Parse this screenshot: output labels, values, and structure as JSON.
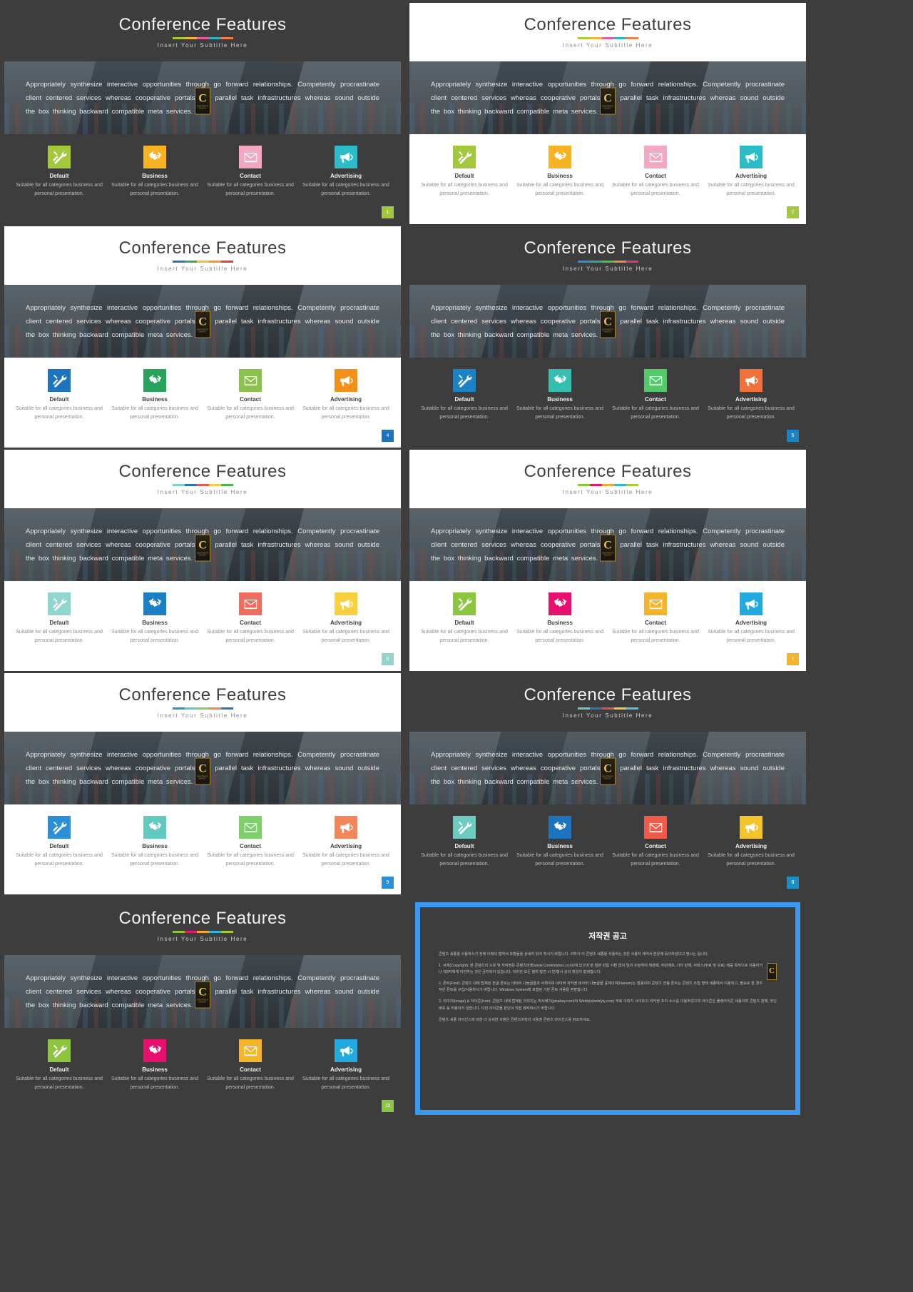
{
  "slide_common": {
    "title": "Conference Features",
    "subtitle": "Insert Your Subtitle Here",
    "paragraph": "Appropriately synthesize interactive opportunities through go forward relationships. Competently procrastinate client centered services whereas cooperative portals and parallel task infrastructures whereas sound outside the box thinking backward compatible meta services.",
    "watermark_letter": "C",
    "watermark_line1": "CONTENTS",
    "watermark_line2": "MARKET",
    "features": [
      {
        "name": "Default",
        "icon": "tools-icon",
        "desc": "Suitable for all categories business and personal presentation."
      },
      {
        "name": "Business",
        "icon": "handshake-icon",
        "desc": "Suitable for all categories business and personal presentation."
      },
      {
        "name": "Contact",
        "icon": "envelope-icon",
        "desc": "Suitable for all categories business and personal presentation."
      },
      {
        "name": "Advertising",
        "icon": "megaphone-icon",
        "desc": "Suitable for all categories business and personal presentation."
      }
    ]
  },
  "slides": [
    {
      "number": "1",
      "theme": "t-dark",
      "rule_colors": [
        "#a8c93a",
        "#f0b53c",
        "#e0609b",
        "#2eb5bd",
        "#f0814a"
      ],
      "icon_colors": [
        "#a4c83c",
        "#f7b322",
        "#f4a8c0",
        "#2cbcc8"
      ],
      "badge_color": "#a4c83c"
    },
    {
      "number": "2",
      "theme": "t-light",
      "rule_colors": [
        "#a8c93a",
        "#f0b53c",
        "#e0609b",
        "#2eb5bd",
        "#f0814a"
      ],
      "icon_colors": [
        "#a4c83c",
        "#f7b322",
        "#f4a8c0",
        "#2cbcc8"
      ],
      "badge_color": "#a4c83c"
    },
    {
      "number": "4",
      "theme": "t-light",
      "rule_colors": [
        "#2f74b5",
        "#3fa65a",
        "#f0c030",
        "#f2962c",
        "#d9443c"
      ],
      "icon_colors": [
        "#1b74bd",
        "#27a35c",
        "#8cc152",
        "#f39019"
      ],
      "badge_color": "#1b74bd"
    },
    {
      "number": "5",
      "theme": "t-dark",
      "rule_colors": [
        "#2f8fd0",
        "#2aa9a0",
        "#4cc04c",
        "#f08a3c",
        "#e0357a"
      ],
      "icon_colors": [
        "#1b82c4",
        "#35bfb0",
        "#52c96a",
        "#f2713a"
      ],
      "badge_color": "#1b82c4"
    },
    {
      "number": "6",
      "theme": "t-light",
      "rule_colors": [
        "#7fd0cc",
        "#2f6fb5",
        "#e0604f",
        "#f2cf4a",
        "#4caf50"
      ],
      "icon_colors": [
        "#8fd6ce",
        "#1b7fc4",
        "#ef6d5a",
        "#f7cf3f"
      ],
      "badge_color": "#8fd6ce"
    },
    {
      "number": "7",
      "theme": "t-light",
      "rule_colors": [
        "#8cc63f",
        "#e01b6a",
        "#f2a93b",
        "#2eb5e0",
        "#a8c93a"
      ],
      "icon_colors": [
        "#8cc63f",
        "#e8106e",
        "#f5b429",
        "#22a9e0"
      ],
      "badge_color": "#f5b429"
    },
    {
      "number": "9",
      "theme": "t-light",
      "rule_colors": [
        "#2f8fd0",
        "#5ec9c0",
        "#7fcf6a",
        "#f2864a",
        "#2f74b5"
      ],
      "icon_colors": [
        "#2a8fd4",
        "#62c9bf",
        "#7ccf6b",
        "#f2865a"
      ],
      "badge_color": "#2a8fd4"
    },
    {
      "number": "8",
      "theme": "t-dark",
      "rule_colors": [
        "#6ec9c0",
        "#2f74b5",
        "#e0554a",
        "#f2c93f",
        "#5ac2d8"
      ],
      "icon_colors": [
        "#6ec9be",
        "#1b74bd",
        "#ef5a4a",
        "#f5c32a"
      ],
      "badge_color": "#1b8fc4"
    },
    {
      "number": "10",
      "theme": "t-dark",
      "rule_colors": [
        "#8cc63f",
        "#e01b6a",
        "#f2a93b",
        "#2eb5e0",
        "#a8c93a"
      ],
      "icon_colors": [
        "#8cc63f",
        "#e8106e",
        "#f5b429",
        "#22a9e0"
      ],
      "badge_color": "#8cc63f"
    }
  ],
  "copyright_slide": {
    "border_color": "#3d98f0",
    "title": "저작권 공고",
    "watermark_letter": "C",
    "paragraphs": [
      "콘텐츠 세종을 사용하시기 전에 아래의 협약서 조항들을 상세히 읽어 주시기 바랍니다. 귀하가 이 콘텐츠 세종을 사용하는 것은 사용자 계약서 본문에 동의하셨다고 명시는 됩니다.",
      "1. 서체(Copyright): 본 콘텐츠의 소유 및 저작권은 콘텐츠마켓(www.Contentsbox.co.kr)에 있으며 본 원본 파일 사본 없이 임의 수정하여 재판매, 무단배포, 기타 판매, 서비스(무료 및 유료) 제공 목적으로 이용하거나 제3자에게 이전하는 것은 금지되어 있습니다. 이러한 모든 행위 발견 시 민/형사 상의 책임이 발생합니다.",
      "2. 폰트(Font): 콘텐츠 내에 탑재된 한글 폰트는 네이버 나눔글꼴과 서체이며 네이버 저작권 네이버 나눔글꼴 윤체이며(Nanum)는 범용이며 콘텐츠 전용 폰트는 콘텐츠 조합 형태 세종에서 이용되고, 필요로 할 경우 작은 폰트를 구입/사용하시기 바랍니다. Windows System에 포함된 기본 폰트 사용을 권장합니다.",
      "3. 이미지(Image) & 아이콘(Icon): 콘텐츠 내에 탑재된 이미지는 픽사베이(pixabay.com)와 Weblyly(weblyly.com) 무료 이미지 사이트의 저작권 프리 소스를 이용하였으며 아이콘은 플랫아이콘 세종이며 콘텐츠 판매, 무단배포 등 허용되지 않습니다. 다만 아이콘을 본인이 직접 제작하시기 바랍니다.",
      "콘텐츠 세종 라이선스에 대한 더 상세한 사항은 콘텐츠마켓의 사용권 콘텐츠 라이선스를 참조하세요."
    ]
  },
  "icons": {
    "tools-icon": "tools",
    "handshake-icon": "handshake",
    "envelope-icon": "envelope",
    "megaphone-icon": "megaphone"
  }
}
